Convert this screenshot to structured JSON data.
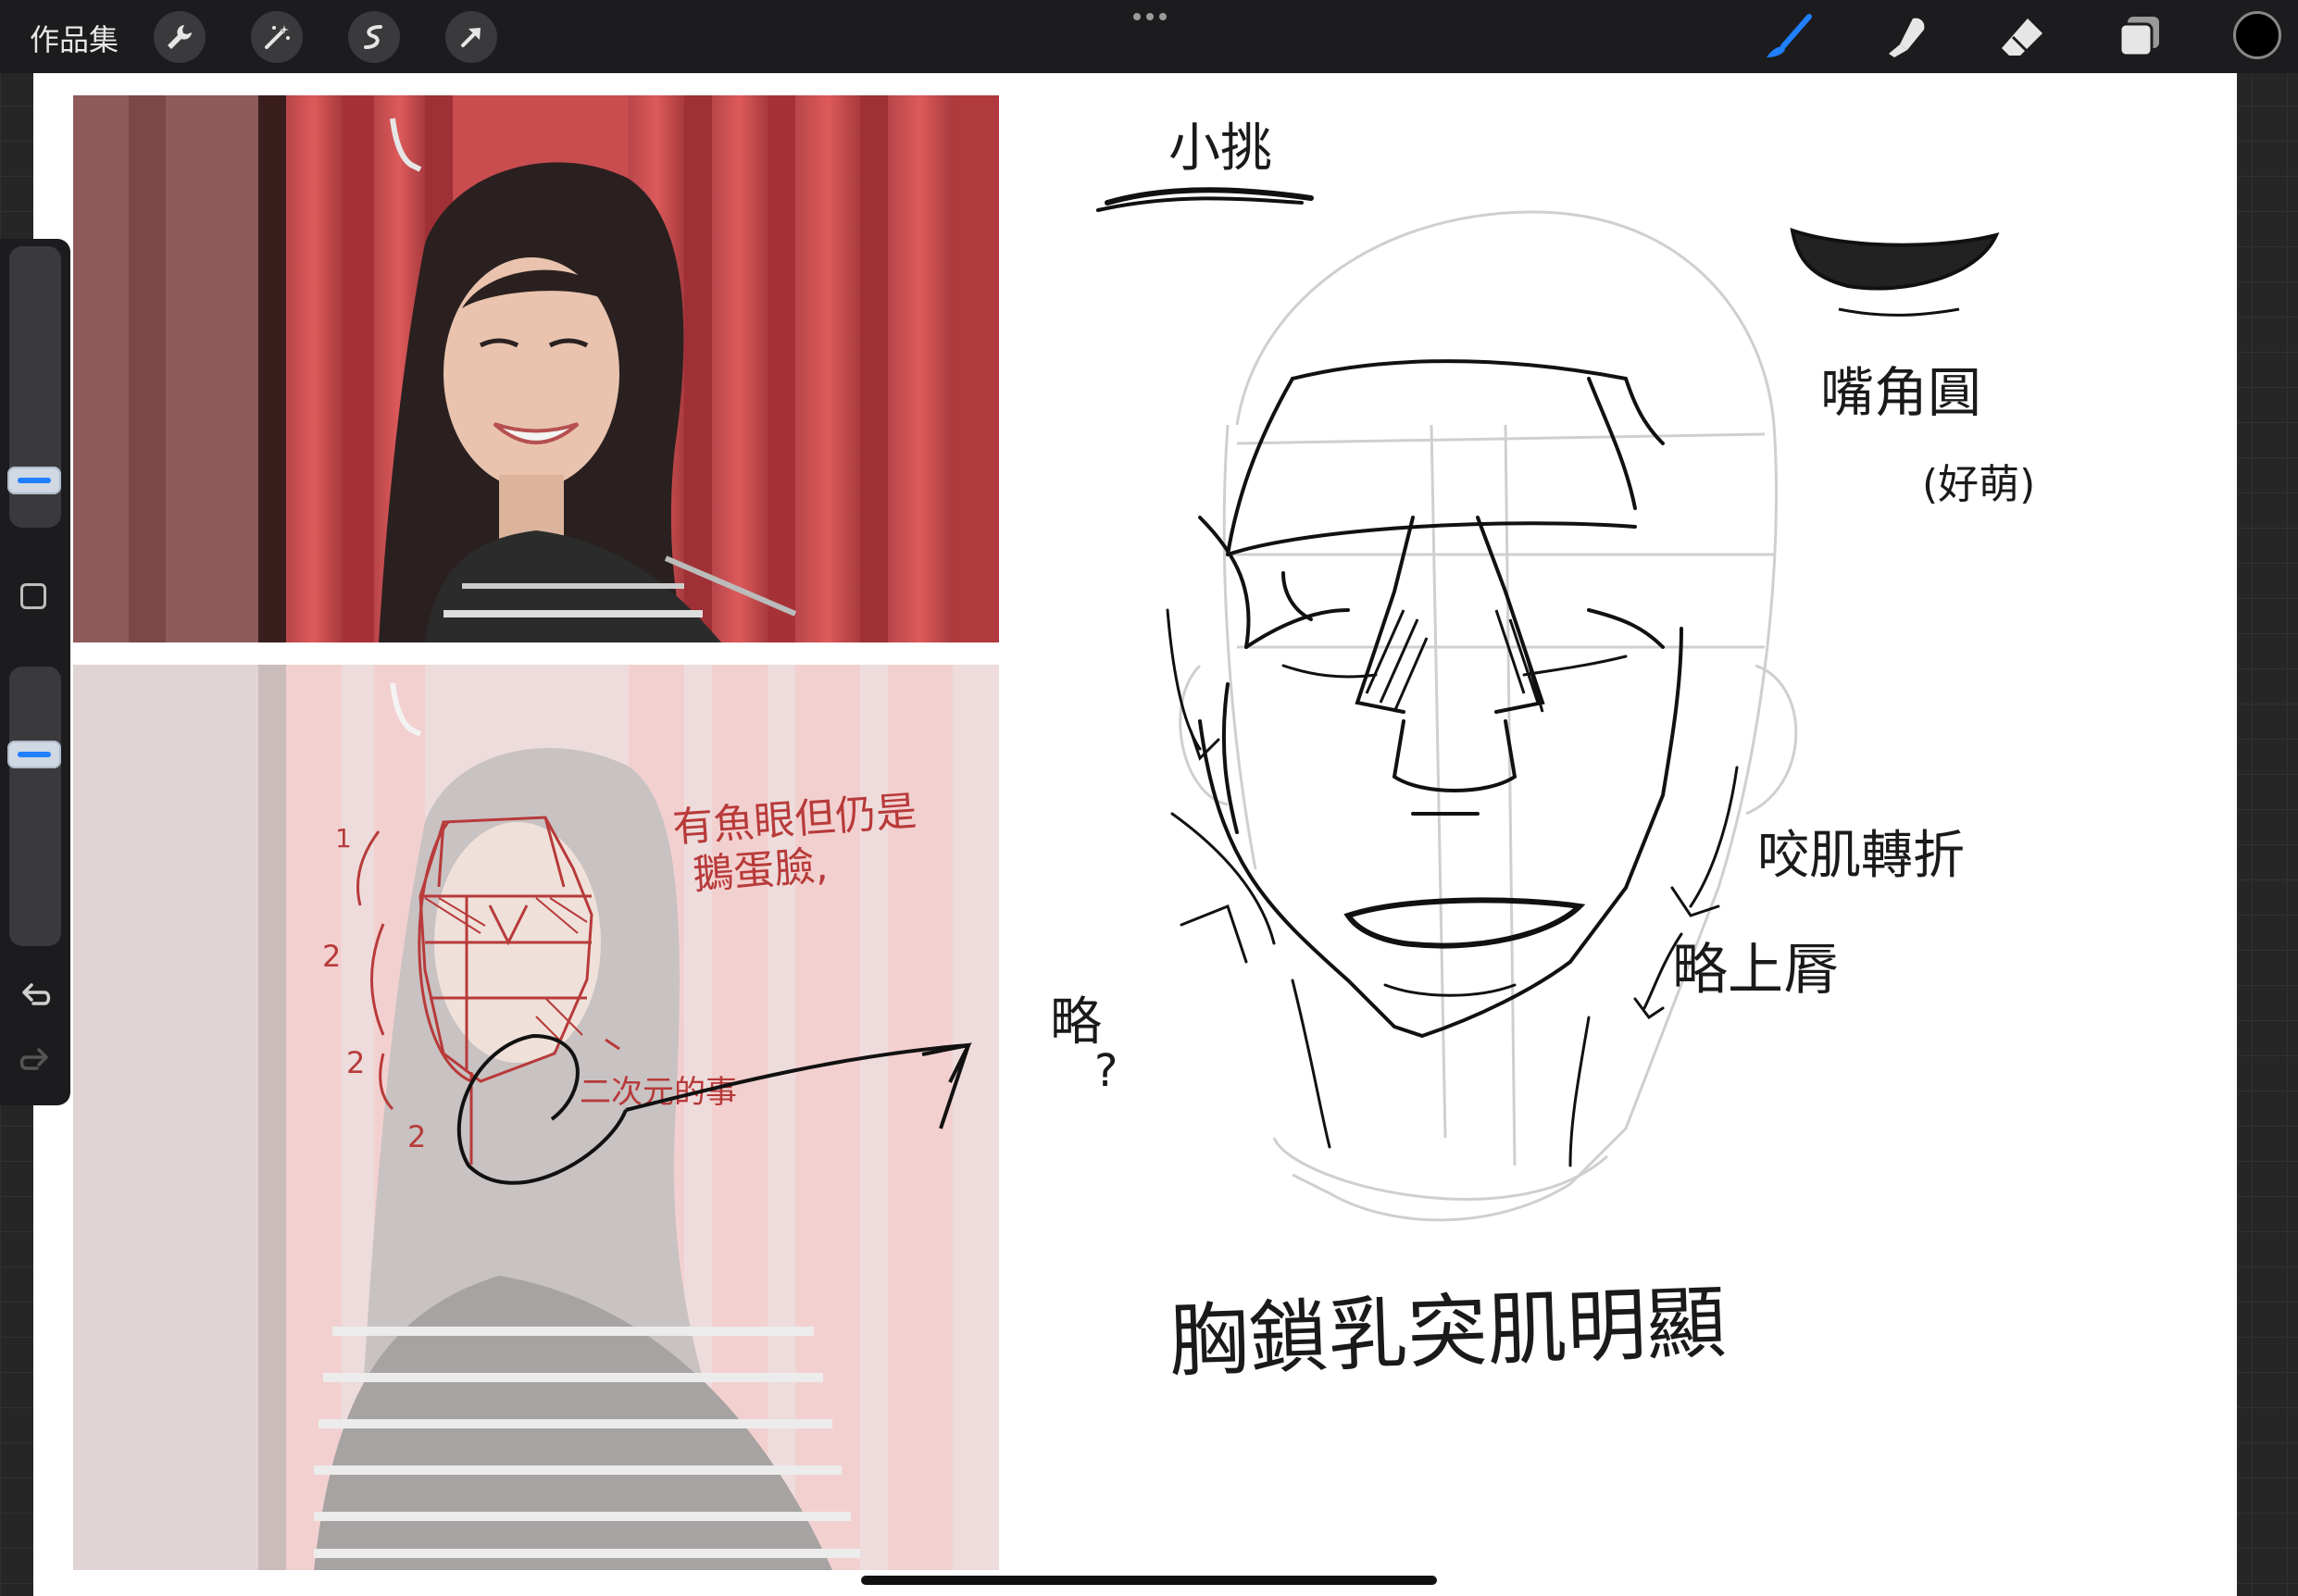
{
  "toolbar": {
    "gallery_label": "作品集",
    "left_tools": [
      "wrench-icon",
      "magic-wand-icon",
      "selection-icon",
      "transform-arrow-icon"
    ],
    "right_tools": [
      "brush-icon",
      "smudge-icon",
      "eraser-icon",
      "layers-icon"
    ],
    "active_tool": "brush-icon",
    "current_color": "#000000",
    "accent_color": "#1f7fff"
  },
  "sidebar": {
    "brush_size_level": 0.32,
    "opacity_level": 0.33,
    "icons": [
      "modify-square-icon",
      "undo-icon",
      "redo-icon"
    ]
  },
  "annotations": {
    "xiaotiao": "小挑",
    "zuijiao": "嘴角圓",
    "haomeng": "(好萌)",
    "yaoji": "咬肌轉折",
    "lue": "略",
    "lue_q": "?",
    "lueshangchun": "略上脣",
    "xiongsuo": "胸鎖乳突肌明顯",
    "red_note_line1": "有魚眼但仍是",
    "red_note_line2": "鵝蛋臉,",
    "red_2d": "二次元的事",
    "red_num_1": "1",
    "red_num_2a": "2",
    "red_num_2b": "2",
    "red_num_2c": "2"
  }
}
